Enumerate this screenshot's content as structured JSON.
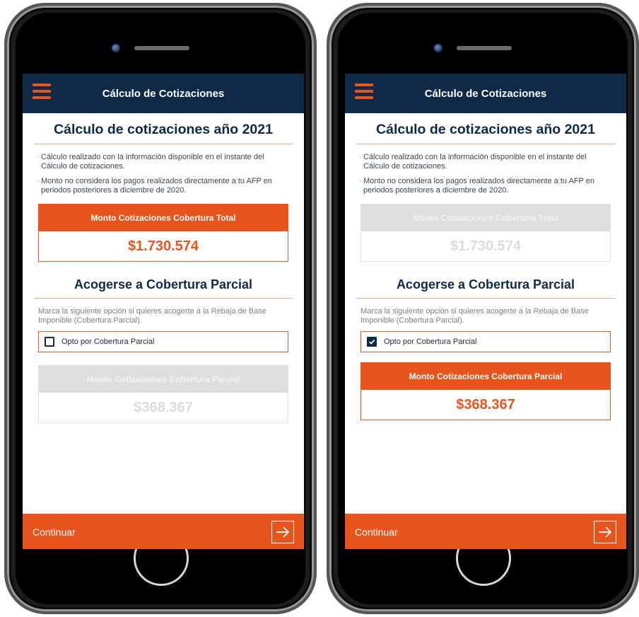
{
  "colors": {
    "accent": "#e8551c",
    "navy": "#0f2a47",
    "disabled": "#dedede"
  },
  "app_bar": {
    "title": "Cálculo de Cotizaciones",
    "menu_icon": "hamburger-menu-icon"
  },
  "main": {
    "heading": "Cálculo de cotizaciones año 2021",
    "notes": [
      "Cálculo realizado con la información disponible en el instante del Cálculo de cotizaciones.",
      "Monto no considera los pagos realizados directamente a tu AFP en periodos posteriores a diciembre de 2020."
    ],
    "total_label": "Monto Cotizaciones Cobertura Total",
    "total_value": "$1.730.574",
    "partial_heading": "Acogerse a Cobertura Parcial",
    "partial_desc": "Marca la siguiente opción si quieres acogerte a la Rebaja de Base Imponible (Cobertura Parcial).",
    "option_label": "Opto por Cobertura Parcial",
    "partial_label": "Monto Cotizaciones Cobertura Parcial",
    "partial_value": "$368.367"
  },
  "footer": {
    "continue_label": "Continuar",
    "next_icon": "arrow-right-icon"
  },
  "screens": [
    {
      "id": "left",
      "option_checked": false,
      "total_enabled": true,
      "partial_enabled": false
    },
    {
      "id": "right",
      "option_checked": true,
      "total_enabled": false,
      "partial_enabled": true
    }
  ]
}
